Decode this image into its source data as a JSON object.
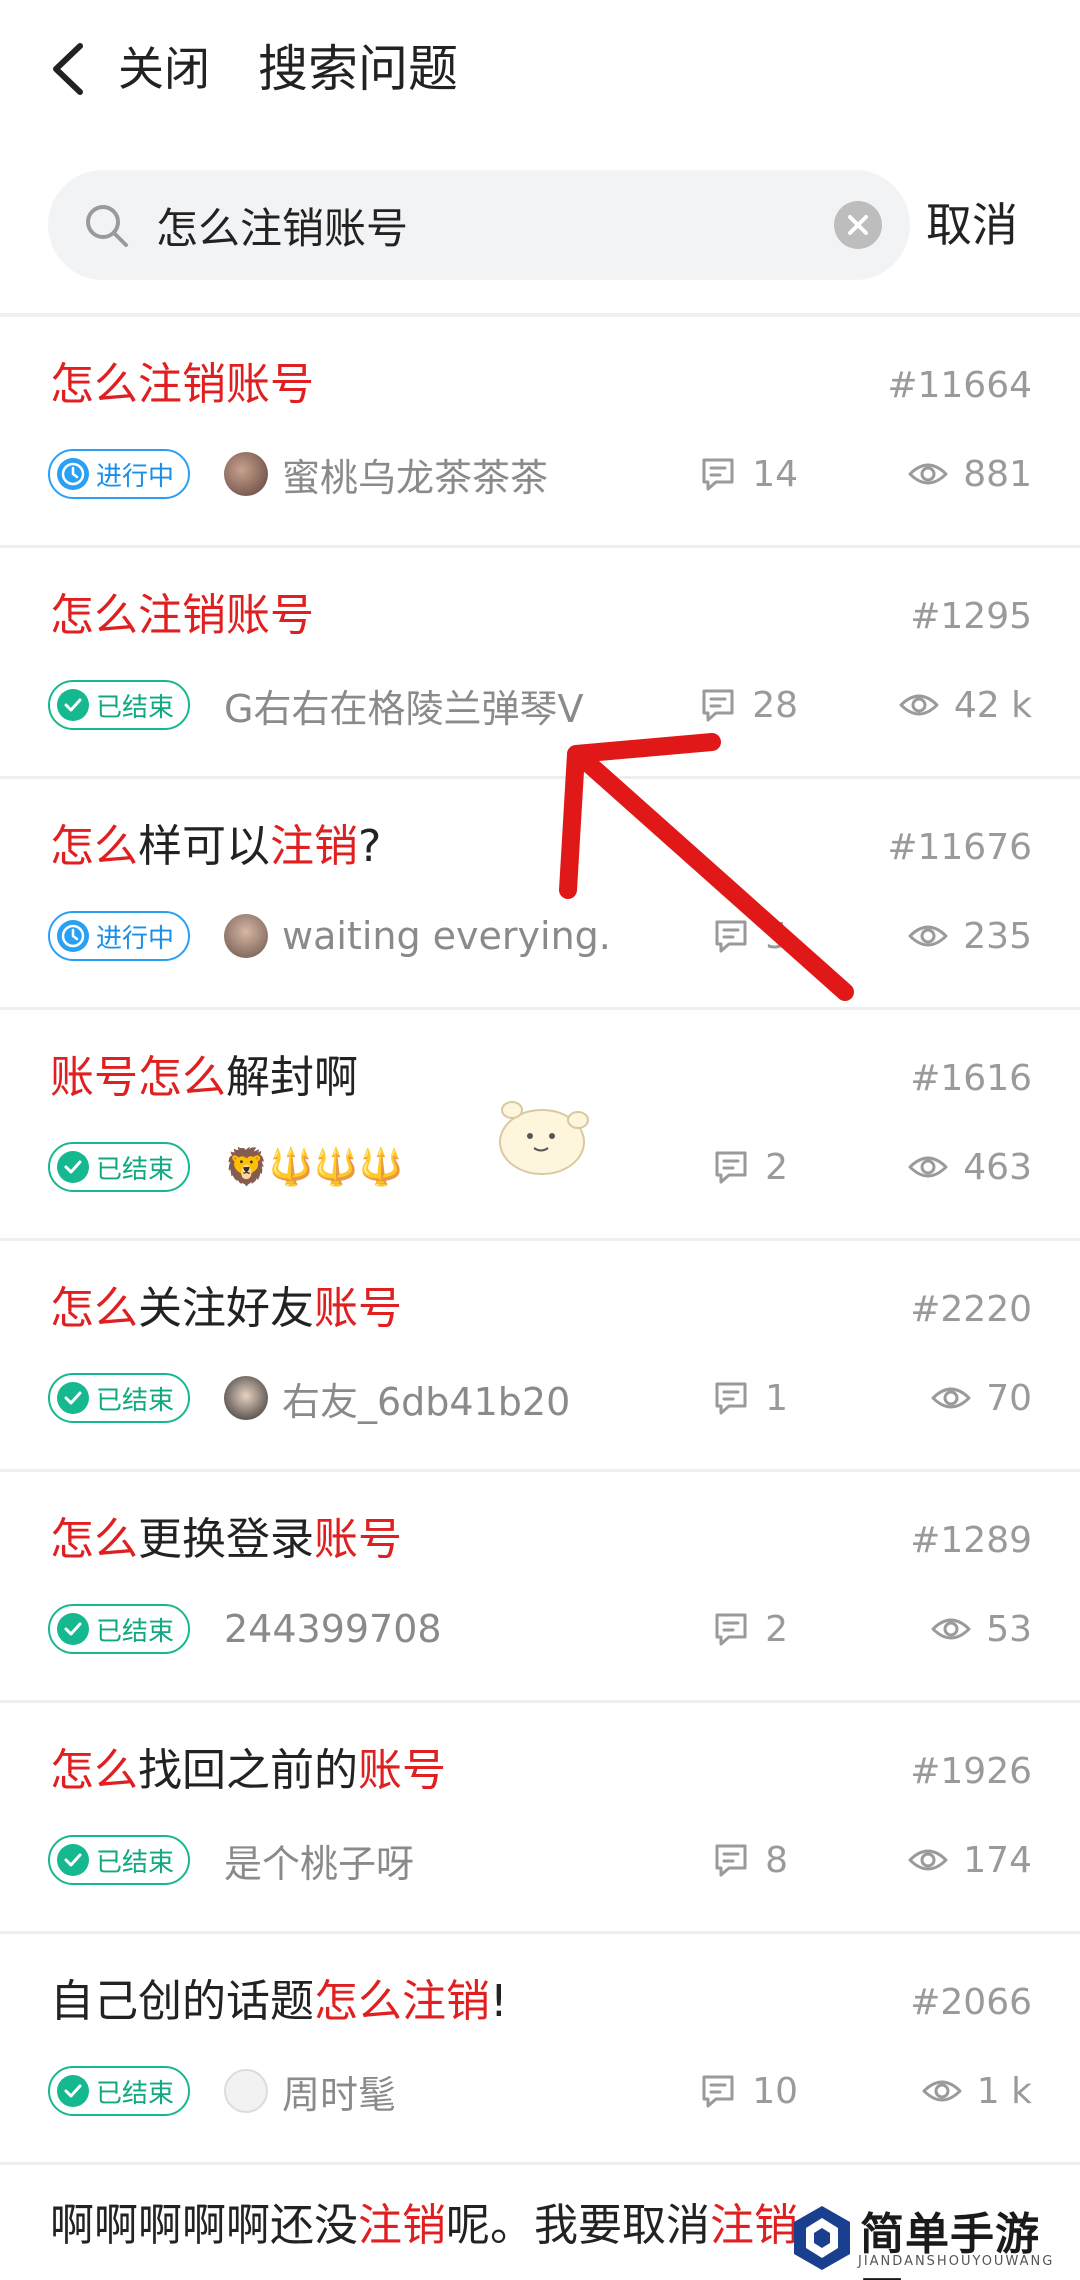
{
  "nav": {
    "back_icon": "chevron-left-icon",
    "close_label": "关闭",
    "title": "搜索问题"
  },
  "search": {
    "value": "怎么注销账号",
    "cancel_label": "取消"
  },
  "results": [
    {
      "title": [
        {
          "t": "怎么注销账号",
          "hl": true
        }
      ],
      "number": "#11664",
      "status": "进行中",
      "author": "蜜桃乌龙茶茶茶",
      "comments": "14",
      "views": "881"
    },
    {
      "title": [
        {
          "t": "怎么注销账号",
          "hl": true
        }
      ],
      "number": "#1295",
      "status": "已结束",
      "author": "G右右在格陵兰弹琴V",
      "comments": "28",
      "views": "42 k"
    },
    {
      "title": [
        {
          "t": "怎么",
          "hl": true
        },
        {
          "t": "样可以",
          "hl": false
        },
        {
          "t": "注销",
          "hl": true
        },
        {
          "t": "?",
          "hl": false
        }
      ],
      "number": "#11676",
      "status": "进行中",
      "author": "waiting everying.",
      "comments": "5",
      "views": "235"
    },
    {
      "title": [
        {
          "t": "账号",
          "hl": true
        },
        {
          "t": "怎么",
          "hl": true
        },
        {
          "t": "解封啊",
          "hl": false
        }
      ],
      "number": "#1616",
      "status": "已结束",
      "author": "🦁🔱🔱🔱",
      "comments": "2",
      "views": "463"
    },
    {
      "title": [
        {
          "t": "怎么",
          "hl": true
        },
        {
          "t": "关注好友",
          "hl": false
        },
        {
          "t": "账号",
          "hl": true
        }
      ],
      "number": "#2220",
      "status": "已结束",
      "author": "右友_6db41b20",
      "comments": "1",
      "views": "70"
    },
    {
      "title": [
        {
          "t": "怎么",
          "hl": true
        },
        {
          "t": "更换登录",
          "hl": false
        },
        {
          "t": "账号",
          "hl": true
        }
      ],
      "number": "#1289",
      "status": "已结束",
      "author": "244399708",
      "comments": "2",
      "views": "53"
    },
    {
      "title": [
        {
          "t": "怎么",
          "hl": true
        },
        {
          "t": "找回之前的",
          "hl": false
        },
        {
          "t": "账号",
          "hl": true
        }
      ],
      "number": "#1926",
      "status": "已结束",
      "author": "是个桃子呀",
      "comments": "8",
      "views": "174"
    },
    {
      "title": [
        {
          "t": "自己创的话题",
          "hl": false
        },
        {
          "t": "怎么注销",
          "hl": true
        },
        {
          "t": "!",
          "hl": false
        }
      ],
      "number": "#2066",
      "status": "已结束",
      "author": "周时髦",
      "comments": "10",
      "views": "1 k"
    }
  ],
  "partial_row": [
    {
      "t": "啊啊啊啊啊还没",
      "hl": false
    },
    {
      "t": "注销",
      "hl": true
    },
    {
      "t": "呢。我要取消",
      "hl": false
    },
    {
      "t": "注销",
      "hl": true
    }
  ],
  "watermark": {
    "text": "简单手游网",
    "sub": "JIANDANSHOUYOUWANG"
  },
  "colors": {
    "highlight": "#e02020",
    "ongoing": "#2aa0f5",
    "ended": "#16b88f",
    "arrow": "#e01818"
  }
}
